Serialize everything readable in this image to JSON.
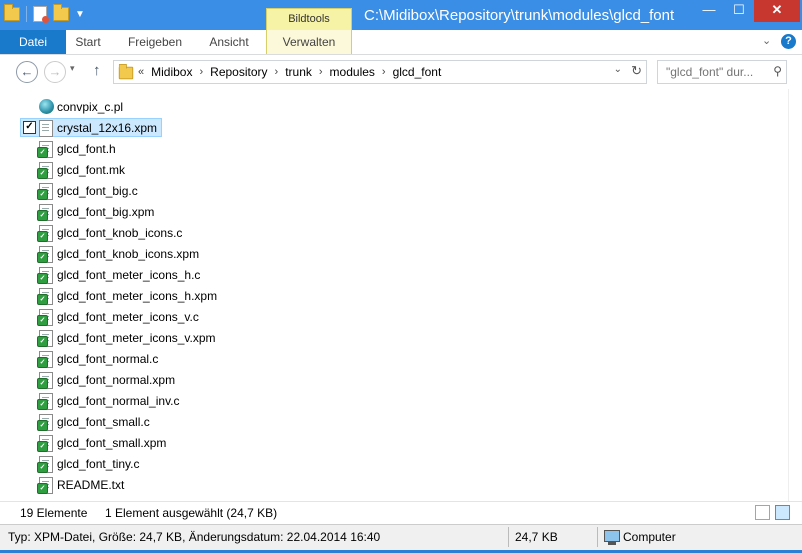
{
  "window": {
    "title": "C:\\Midibox\\Repository\\trunk\\modules\\glcd_font",
    "tool_tab": "Bildtools",
    "minimize": "—",
    "maximize": "☐",
    "close": "✕"
  },
  "ribbon": {
    "tabs": [
      {
        "label": "Datei"
      },
      {
        "label": "Start"
      },
      {
        "label": "Freigeben"
      },
      {
        "label": "Ansicht"
      },
      {
        "label": "Verwalten"
      }
    ],
    "expand_glyph": "⌄",
    "help_glyph": "?"
  },
  "nav": {
    "back": "←",
    "forward": "→",
    "recent": "▾",
    "up": "↑"
  },
  "address": {
    "prefix": "«",
    "crumbs": [
      "Midibox",
      "Repository",
      "trunk",
      "modules",
      "glcd_font"
    ],
    "separator": "›",
    "dropdown": "⌄",
    "refresh": "↻"
  },
  "search": {
    "placeholder": "\"glcd_font\" dur..."
  },
  "files": [
    {
      "name": "convpix_c.pl",
      "icon": "perl-script-icon",
      "selected": false
    },
    {
      "name": "crystal_12x16.xpm",
      "icon": "blank-file-icon",
      "selected": true
    },
    {
      "name": "glcd_font.h",
      "icon": "svn-file-icon",
      "selected": false
    },
    {
      "name": "glcd_font.mk",
      "icon": "svn-file-icon",
      "selected": false
    },
    {
      "name": "glcd_font_big.c",
      "icon": "svn-file-icon",
      "selected": false
    },
    {
      "name": "glcd_font_big.xpm",
      "icon": "svn-file-icon",
      "selected": false
    },
    {
      "name": "glcd_font_knob_icons.c",
      "icon": "svn-file-icon",
      "selected": false
    },
    {
      "name": "glcd_font_knob_icons.xpm",
      "icon": "svn-file-icon",
      "selected": false
    },
    {
      "name": "glcd_font_meter_icons_h.c",
      "icon": "svn-file-icon",
      "selected": false
    },
    {
      "name": "glcd_font_meter_icons_h.xpm",
      "icon": "svn-file-icon",
      "selected": false
    },
    {
      "name": "glcd_font_meter_icons_v.c",
      "icon": "svn-file-icon",
      "selected": false
    },
    {
      "name": "glcd_font_meter_icons_v.xpm",
      "icon": "svn-file-icon",
      "selected": false
    },
    {
      "name": "glcd_font_normal.c",
      "icon": "svn-file-icon",
      "selected": false
    },
    {
      "name": "glcd_font_normal.xpm",
      "icon": "svn-file-icon",
      "selected": false
    },
    {
      "name": "glcd_font_normal_inv.c",
      "icon": "svn-file-icon",
      "selected": false
    },
    {
      "name": "glcd_font_small.c",
      "icon": "svn-file-icon",
      "selected": false
    },
    {
      "name": "glcd_font_small.xpm",
      "icon": "svn-file-icon",
      "selected": false
    },
    {
      "name": "glcd_font_tiny.c",
      "icon": "svn-file-icon",
      "selected": false
    },
    {
      "name": "README.txt",
      "icon": "svn-file-icon",
      "selected": false
    }
  ],
  "status": {
    "count": "19 Elemente",
    "selection": "1 Element ausgewählt (24,7 KB)"
  },
  "info": {
    "details": "Typ: XPM-Datei, Größe: 24,7 KB, Änderungsdatum: 22.04.2014 16:40",
    "size": "24,7 KB",
    "location": "Computer"
  },
  "colors": {
    "accent": "#1979ca",
    "title_bar": "#3a8ee6",
    "tool_tab": "#f6f2a6",
    "selection": "#cce8ff",
    "close": "#c7362f"
  }
}
